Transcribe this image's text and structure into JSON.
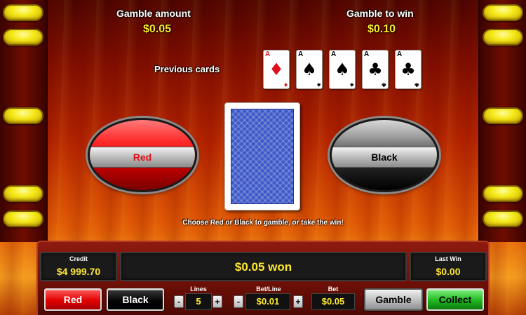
{
  "gamble_amount": {
    "label": "Gamble amount",
    "value": "$0.05"
  },
  "gamble_to_win": {
    "label": "Gamble to win",
    "value": "$0.10"
  },
  "previous_cards": {
    "label": "Previous cards",
    "cards": [
      {
        "rank": "A",
        "suit": "♦",
        "color": "red"
      },
      {
        "rank": "A",
        "suit": "♠",
        "color": "black"
      },
      {
        "rank": "A",
        "suit": "♠",
        "color": "black"
      },
      {
        "rank": "A",
        "suit": "♣",
        "color": "black"
      },
      {
        "rank": "A",
        "suit": "♣",
        "color": "black"
      }
    ]
  },
  "choice_buttons": {
    "red": "Red",
    "black": "Black"
  },
  "instruction": "Choose Red or Black to gamble, or take the win!",
  "panel": {
    "credit": {
      "label": "Credit",
      "value": "$4 999.70"
    },
    "message": "$0.05 won",
    "last_win": {
      "label": "Last Win",
      "value": "$0.00"
    },
    "red_button": "Red",
    "black_button": "Black",
    "lines": {
      "label": "Lines",
      "value": "5"
    },
    "bet_line": {
      "label": "Bet/Line",
      "value": "$0.01"
    },
    "bet": {
      "label": "Bet",
      "value": "$0.05"
    },
    "minus": "-",
    "plus": "+",
    "gamble_button": "Gamble",
    "collect_button": "Collect"
  },
  "colors": {
    "accent_yellow": "#ffe92e",
    "red": "#e10000",
    "green": "#1fb81f",
    "card_back": "#3d58c8"
  }
}
